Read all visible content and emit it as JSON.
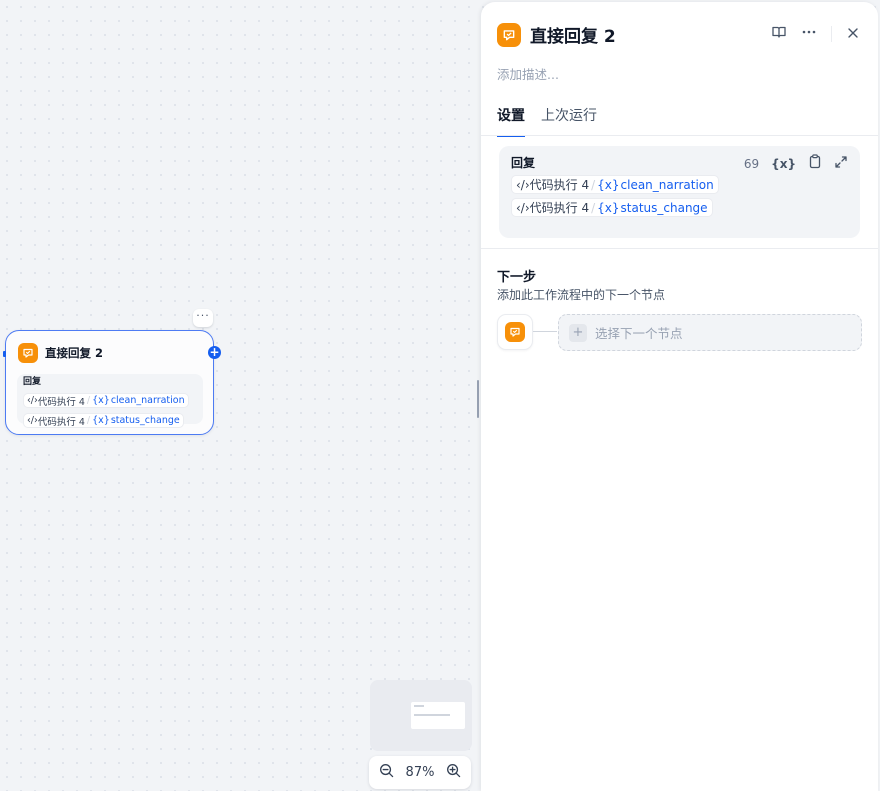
{
  "node": {
    "title": "直接回复 2",
    "body_label": "回复",
    "more_label": "···",
    "plus_label": "+",
    "chips": [
      {
        "source": "代码执行 4",
        "var": "clean_narration"
      },
      {
        "source": "代码执行 4",
        "var": "status_change"
      }
    ]
  },
  "zoom": {
    "level": "87%"
  },
  "panel": {
    "title": "直接回复 2",
    "description_placeholder": "添加描述...",
    "tabs": [
      {
        "label": "设置",
        "active": true
      },
      {
        "label": "上次运行",
        "active": false
      }
    ],
    "reply": {
      "label": "回复",
      "count": "69",
      "var_icon": "{x}",
      "chips": [
        {
          "source": "代码执行 4",
          "var": "clean_narration"
        },
        {
          "source": "代码执行 4",
          "var": "status_change"
        }
      ]
    },
    "next": {
      "title": "下一步",
      "description": "添加此工作流程中的下一个节点",
      "select_label": "选择下一个节点",
      "plus_label": "+"
    }
  },
  "colors": {
    "accent": "#155eef",
    "node_icon": "#f79009",
    "border_selected": "#4d7bf3"
  },
  "icons": [
    "reply-icon",
    "book-icon",
    "more-icon",
    "close-icon",
    "variable-icon",
    "clipboard-icon",
    "expand-icon",
    "zoom-out-icon",
    "zoom-in-icon",
    "code-icon"
  ]
}
